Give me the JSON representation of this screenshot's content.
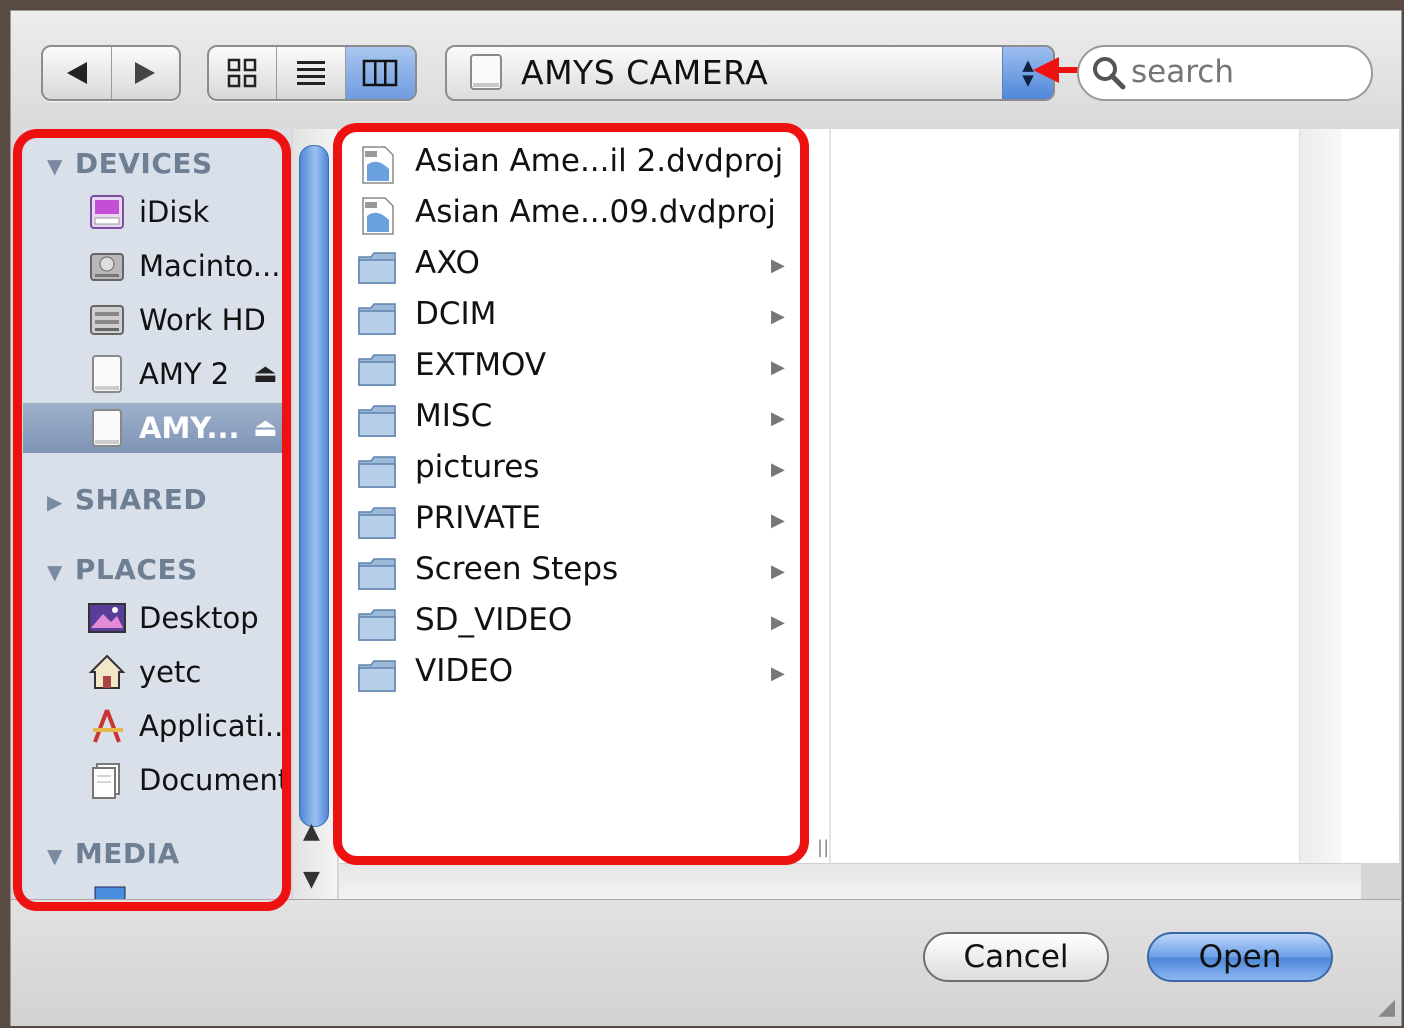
{
  "toolbar": {
    "location": "AMYS CAMERA",
    "search_placeholder": "search"
  },
  "sidebar": {
    "sections": {
      "devices": "DEVICES",
      "shared": "SHARED",
      "places": "PLACES",
      "media": "MEDIA"
    },
    "devices": [
      "iDisk",
      "Macinto...",
      "Work HD",
      "AMY 2",
      "AMY..."
    ],
    "places": [
      "Desktop",
      "yetc",
      "Applicati...",
      "Documents"
    ],
    "eject_glyph": "⏏",
    "selected": "AMY..."
  },
  "browser": {
    "items": [
      {
        "name": "Asian Ame...il 2.dvdproj",
        "kind": "file"
      },
      {
        "name": "Asian Ame...09.dvdproj",
        "kind": "file"
      },
      {
        "name": "AXO",
        "kind": "folder"
      },
      {
        "name": "DCIM",
        "kind": "folder"
      },
      {
        "name": "EXTMOV",
        "kind": "folder"
      },
      {
        "name": "MISC",
        "kind": "folder"
      },
      {
        "name": "pictures",
        "kind": "folder"
      },
      {
        "name": "PRIVATE",
        "kind": "folder"
      },
      {
        "name": "Screen Steps",
        "kind": "folder"
      },
      {
        "name": "SD_VIDEO",
        "kind": "folder"
      },
      {
        "name": "VIDEO",
        "kind": "folder"
      }
    ]
  },
  "buttons": {
    "cancel": "Cancel",
    "open": "Open"
  },
  "colors": {
    "highlight": "#ee1111",
    "sidebar_bg": "#d9e0ea",
    "accent_blue": "#4f86d5"
  }
}
